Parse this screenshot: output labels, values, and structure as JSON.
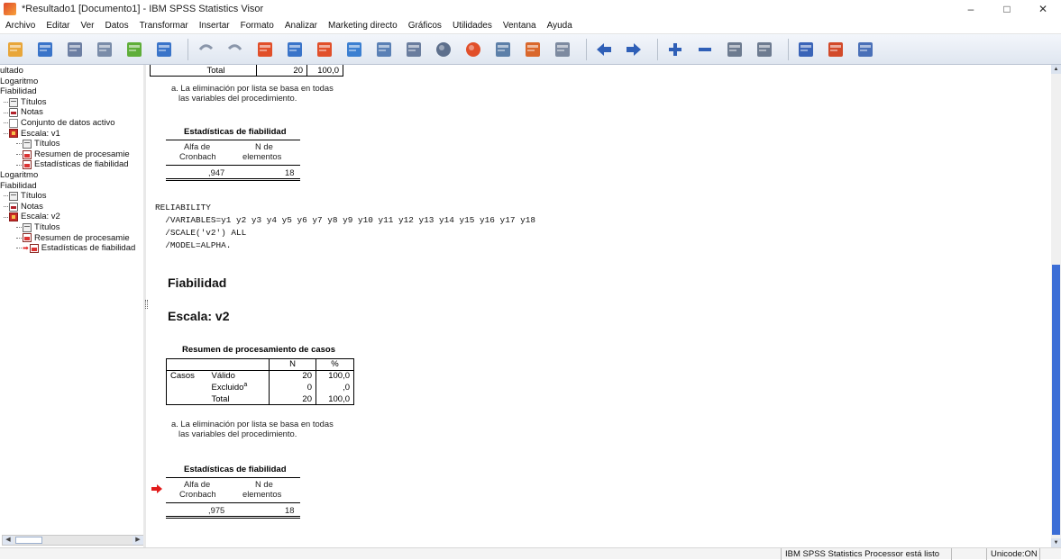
{
  "window": {
    "title": "*Resultado1 [Documento1] - IBM SPSS Statistics Visor",
    "minimize": "–",
    "maximize": "□",
    "close": "✕"
  },
  "menu": [
    "Archivo",
    "Editar",
    "Ver",
    "Datos",
    "Transformar",
    "Insertar",
    "Formato",
    "Analizar",
    "Marketing directo",
    "Gráficos",
    "Utilidades",
    "Ventana",
    "Ayuda"
  ],
  "toolbar_icons": [
    "open-icon",
    "save-icon",
    "print-icon",
    "print-preview-icon",
    "export-icon",
    "go-to-data-icon",
    "undo-icon",
    "redo-icon",
    "go-to-case-icon",
    "go-to-variable-icon",
    "insert-cases-icon",
    "insert-variable-icon",
    "split-file-icon",
    "weight-cases-icon",
    "select-cases-icon",
    "value-labels-icon",
    "use-sets-icon",
    "show-all-variables-icon",
    "designate-window-icon",
    "previous-icon",
    "next-icon",
    "expand-icon",
    "collapse-icon",
    "show-icon",
    "hide-icon",
    "insert-heading-icon",
    "insert-title-icon",
    "insert-text-icon"
  ],
  "outline": [
    {
      "label": "ultado",
      "indent": 0,
      "icon": ""
    },
    {
      "label": "Logaritmo",
      "indent": 0,
      "icon": ""
    },
    {
      "label": "Fiabilidad",
      "indent": 0,
      "icon": ""
    },
    {
      "label": "Títulos",
      "indent": 1,
      "icon": "titles"
    },
    {
      "label": "Notas",
      "indent": 1,
      "icon": "notes"
    },
    {
      "label": "Conjunto de datos activo",
      "indent": 1,
      "icon": "data"
    },
    {
      "label": "Escala: v1",
      "indent": 1,
      "icon": "scale"
    },
    {
      "label": "Títulos",
      "indent": 2,
      "icon": "titles"
    },
    {
      "label": "Resumen de procesamie",
      "indent": 2,
      "icon": "table"
    },
    {
      "label": "Estadísticas de fiabilidad",
      "indent": 2,
      "icon": "table"
    },
    {
      "label": "Logaritmo",
      "indent": 0,
      "icon": ""
    },
    {
      "label": "Fiabilidad",
      "indent": 0,
      "icon": ""
    },
    {
      "label": "Títulos",
      "indent": 1,
      "icon": "titles"
    },
    {
      "label": "Notas",
      "indent": 1,
      "icon": "notes"
    },
    {
      "label": "Escala: v2",
      "indent": 1,
      "icon": "scale"
    },
    {
      "label": "Títulos",
      "indent": 2,
      "icon": "titles"
    },
    {
      "label": "Resumen de procesamie",
      "indent": 2,
      "icon": "table"
    },
    {
      "label": "Estadísticas de fiabilidad",
      "indent": 2,
      "icon": "table",
      "current": true
    }
  ],
  "top_partial": {
    "total_label": "Total",
    "n": "20",
    "pct": "100,0",
    "note_line1": "a. La eliminación por lista se basa en todas",
    "note_line2": "las variables del procedimiento."
  },
  "fiab1": {
    "title": "Estadísticas de fiabilidad",
    "col1_line1": "Alfa de",
    "col1_line2": "Cronbach",
    "col2_line1": "N de",
    "col2_line2": "elementos",
    "alpha": ",947",
    "n": "18"
  },
  "syntax": [
    "RELIABILITY",
    "  /VARIABLES=y1 y2 y3 y4 y5 y6 y7 y8 y9 y10 y11 y12 y13 y14 y15 y16 y17 y18",
    "  /SCALE('v2') ALL",
    "  /MODEL=ALPHA."
  ],
  "heading_fiabilidad": "Fiabilidad",
  "heading_scale": "Escala: v2",
  "resumen2": {
    "title": "Resumen de procesamiento de casos",
    "col_n": "N",
    "col_pct": "%",
    "row_group": "Casos",
    "rows": [
      {
        "label": "Válido",
        "sup": "",
        "n": "20",
        "pct": "100,0"
      },
      {
        "label": "Excluido",
        "sup": "a",
        "n": "0",
        "pct": ",0"
      },
      {
        "label": "Total",
        "sup": "",
        "n": "20",
        "pct": "100,0"
      }
    ],
    "note_line1": "a. La eliminación por lista se basa en todas",
    "note_line2": "las variables del procedimiento."
  },
  "fiab2": {
    "title": "Estadísticas de fiabilidad",
    "col1_line1": "Alfa de",
    "col1_line2": "Cronbach",
    "col2_line1": "N de",
    "col2_line2": "elementos",
    "alpha": ",975",
    "n": "18"
  },
  "status": {
    "processor": "IBM SPSS Statistics Processor está listo",
    "unicode": "Unicode:ON"
  },
  "colors": {
    "current_arrow": "#e21b1b",
    "scroll_thumb": "#3c6ed6"
  }
}
